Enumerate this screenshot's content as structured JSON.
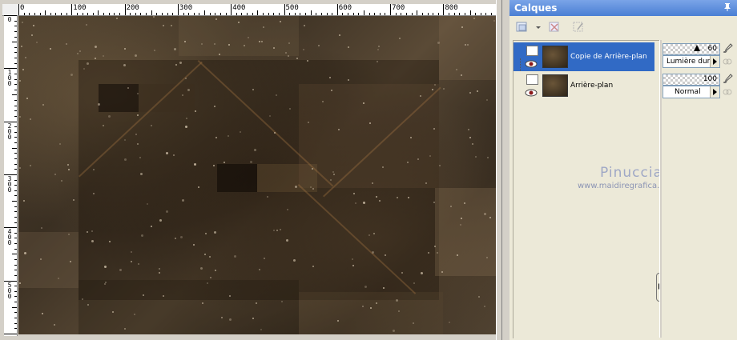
{
  "ruler": {
    "h_labels": [
      "0",
      "100",
      "200",
      "300",
      "400",
      "500",
      "600",
      "700",
      "800"
    ],
    "v_labels": [
      "0",
      "100",
      "200",
      "300",
      "400",
      "500"
    ]
  },
  "layers_panel": {
    "title": "Calques",
    "pin_icon": "pin-icon",
    "toolbar_icons": [
      "new-layer-icon",
      "dropdown-arrow-icon",
      "delete-layer-icon",
      "edit-mask-icon"
    ],
    "layers": [
      {
        "name": "Copie de Arrière-plan",
        "selected": true,
        "opacity": "60",
        "blend_mode": "Lumière dure"
      },
      {
        "name": "Arrière-plan",
        "selected": false,
        "opacity": "100",
        "blend_mode": "Normal"
      }
    ]
  },
  "watermark": {
    "name": "Pinuccia",
    "url": "www.maidiregrafica.eu"
  },
  "colors": {
    "selection": "#316ac5",
    "titlebar": "#4a7fd4",
    "panel_bg": "#ece9d8",
    "chrome": "#d4d0c8"
  }
}
